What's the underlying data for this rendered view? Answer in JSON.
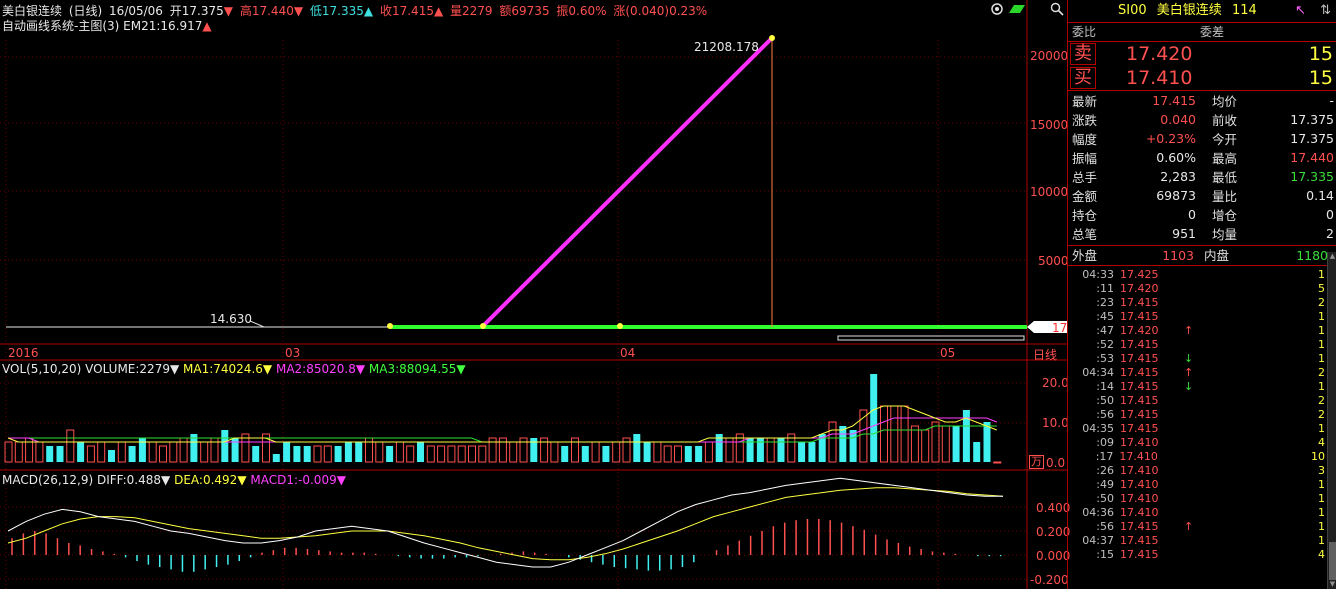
{
  "header": {
    "name": "美白银连续",
    "period": "(日线)",
    "date": "16/05/06",
    "open": "开17.375",
    "high": "高17.440",
    "low": "低17.335",
    "close": "收17.415",
    "volume": "量2279",
    "amount": "额69735",
    "amplitude": "振0.60%",
    "change": "涨(0.040)0.23%",
    "subtitle1": "自动画线系统-主图(3)",
    "subtitle2": "EM21:16.917"
  },
  "main_chart": {
    "peak_label": "21208.178",
    "trough_label": "14.630",
    "y_ticks": [
      "20000",
      "15000",
      "10000",
      "5000"
    ],
    "current_marker": "17",
    "x_ticks": [
      "2016",
      "03",
      "04",
      "05"
    ],
    "period_tag": "日线"
  },
  "volume_chart": {
    "title": "VOL(5,10,20)",
    "vol": "VOLUME:2279",
    "ma1": "MA1:74024.6",
    "ma2": "MA2:85020.8",
    "ma3": "MA3:88094.55",
    "y_ticks": [
      "20.0",
      "10.0",
      "0.0"
    ],
    "unit_label": "万",
    "bars": [
      5,
      5,
      6,
      5,
      4,
      4,
      8,
      5,
      4,
      5,
      3,
      5,
      4,
      6,
      5,
      4,
      5,
      6,
      7,
      5,
      6,
      8,
      6,
      7,
      4,
      7,
      2,
      5,
      4,
      4,
      4,
      4,
      4,
      5,
      5,
      6,
      5,
      4,
      5,
      4,
      5,
      4,
      4,
      4,
      4,
      4,
      4,
      6,
      6,
      5,
      6,
      6,
      6,
      5,
      4,
      6,
      4,
      5,
      4,
      5,
      6,
      7,
      5,
      5,
      4,
      4,
      4,
      4,
      5,
      7,
      6,
      7,
      6,
      6,
      6,
      6,
      7,
      5,
      5,
      7,
      10,
      9,
      8,
      13,
      22,
      14,
      14,
      14,
      9,
      8,
      10,
      9,
      9,
      13,
      5,
      10,
      0
    ],
    "bar_colors": [
      "r",
      "r",
      "r",
      "r",
      "c",
      "c",
      "r",
      "c",
      "r",
      "r",
      "c",
      "r",
      "c",
      "c",
      "r",
      "r",
      "r",
      "r",
      "c",
      "r",
      "r",
      "c",
      "c",
      "r",
      "c",
      "r",
      "c",
      "c",
      "c",
      "c",
      "r",
      "r",
      "c",
      "c",
      "c",
      "r",
      "r",
      "c",
      "r",
      "r",
      "c",
      "r",
      "r",
      "r",
      "r",
      "r",
      "r",
      "r",
      "r",
      "r",
      "r",
      "c",
      "r",
      "r",
      "c",
      "r",
      "c",
      "r",
      "c",
      "r",
      "r",
      "c",
      "c",
      "r",
      "r",
      "r",
      "c",
      "c",
      "r",
      "c",
      "r",
      "r",
      "c",
      "c",
      "r",
      "c",
      "r",
      "c",
      "c",
      "c",
      "r",
      "c",
      "c",
      "r",
      "c",
      "r",
      "r",
      "r",
      "r",
      "r",
      "r",
      "r",
      "c",
      "c",
      "c",
      "c",
      "r"
    ],
    "ma_a": [
      6,
      5,
      5,
      5,
      5,
      5,
      5,
      5,
      5,
      5,
      5,
      5,
      5,
      5,
      5,
      5,
      5,
      5,
      5,
      5,
      5,
      5,
      6,
      6,
      6,
      6,
      5,
      5,
      5,
      5,
      5,
      5,
      5,
      5,
      5,
      5,
      5,
      5,
      5,
      5,
      5,
      5,
      5,
      5,
      5,
      5,
      5,
      5,
      5,
      5,
      5,
      5,
      5,
      5,
      5,
      5,
      5,
      5,
      5,
      5,
      5,
      5,
      5,
      5,
      5,
      5,
      5,
      5,
      6,
      6,
      6,
      6,
      6,
      6,
      6,
      6,
      6,
      6,
      6,
      7,
      8,
      8,
      9,
      11,
      13,
      14,
      14,
      14,
      13,
      12,
      11,
      10,
      10,
      11,
      10,
      9,
      8
    ],
    "ma_b": [
      6,
      6,
      6,
      5,
      5,
      5,
      5,
      5,
      5,
      5,
      5,
      5,
      5,
      5,
      5,
      5,
      5,
      5,
      5,
      5,
      5,
      5,
      5,
      5,
      5,
      5,
      5,
      5,
      5,
      5,
      5,
      5,
      5,
      5,
      5,
      5,
      5,
      5,
      5,
      5,
      5,
      5,
      5,
      5,
      5,
      5,
      5,
      5,
      5,
      5,
      5,
      5,
      5,
      5,
      5,
      5,
      5,
      5,
      5,
      5,
      5,
      5,
      5,
      5,
      5,
      5,
      5,
      5,
      5,
      5,
      5,
      5,
      6,
      6,
      6,
      6,
      6,
      6,
      6,
      6,
      7,
      7,
      7,
      8,
      9,
      10,
      11,
      11,
      11,
      11,
      11,
      11,
      11,
      11,
      11,
      11,
      10
    ],
    "ma_c": [
      6,
      6,
      6,
      6,
      6,
      6,
      6,
      6,
      6,
      6,
      6,
      6,
      6,
      6,
      6,
      6,
      6,
      6,
      6,
      6,
      6,
      6,
      6,
      6,
      6,
      6,
      6,
      6,
      6,
      6,
      6,
      6,
      6,
      6,
      6,
      6,
      6,
      6,
      6,
      6,
      6,
      6,
      6,
      6,
      6,
      6,
      5,
      5,
      5,
      5,
      5,
      5,
      5,
      5,
      5,
      5,
      5,
      5,
      5,
      5,
      5,
      5,
      5,
      5,
      5,
      5,
      5,
      5,
      5,
      5,
      5,
      5,
      5,
      5,
      5,
      5,
      5,
      5,
      5,
      6,
      6,
      6,
      6,
      7,
      7,
      8,
      8,
      8,
      8,
      8,
      9,
      9,
      9,
      9,
      9,
      9,
      9
    ]
  },
  "macd_chart": {
    "title": "MACD(26,12,9)",
    "diff": "DIFF:0.488",
    "dea": "DEA:0.492",
    "macd1": "MACD1:-0.009",
    "y_ticks": [
      "0.400",
      "0.200",
      "0.000",
      "-0.200"
    ],
    "hist": [
      0.14,
      0.18,
      0.2,
      0.18,
      0.14,
      0.1,
      0.08,
      0.05,
      0.03,
      0.01,
      -0.02,
      -0.05,
      -0.08,
      -0.1,
      -0.12,
      -0.14,
      -0.14,
      -0.12,
      -0.1,
      -0.08,
      -0.05,
      -0.02,
      0.02,
      0.04,
      0.06,
      0.06,
      0.05,
      0.04,
      0.03,
      0.02,
      0.02,
      0.02,
      0.01,
      0.0,
      -0.01,
      -0.02,
      -0.03,
      -0.03,
      -0.03,
      -0.02,
      -0.02,
      -0.01,
      0.0,
      0.01,
      0.02,
      0.03,
      0.02,
      0.01,
      0.0,
      -0.02,
      -0.04,
      -0.06,
      -0.08,
      -0.1,
      -0.11,
      -0.12,
      -0.13,
      -0.13,
      -0.12,
      -0.1,
      -0.06,
      0.0,
      0.04,
      0.08,
      0.12,
      0.16,
      0.2,
      0.24,
      0.27,
      0.29,
      0.3,
      0.3,
      0.29,
      0.27,
      0.24,
      0.21,
      0.17,
      0.13,
      0.1,
      0.07,
      0.05,
      0.03,
      0.02,
      0.01,
      0.0,
      -0.01,
      -0.01,
      -0.01
    ],
    "diff_line": [
      0.2,
      0.28,
      0.34,
      0.38,
      0.36,
      0.32,
      0.3,
      0.28,
      0.24,
      0.2,
      0.18,
      0.15,
      0.12,
      0.1,
      0.1,
      0.12,
      0.15,
      0.2,
      0.22,
      0.24,
      0.22,
      0.2,
      0.15,
      0.1,
      0.06,
      0.02,
      -0.02,
      -0.06,
      -0.08,
      -0.1,
      -0.1,
      -0.06,
      0.0,
      0.06,
      0.12,
      0.2,
      0.28,
      0.36,
      0.42,
      0.46,
      0.5,
      0.52,
      0.55,
      0.58,
      0.6,
      0.62,
      0.64,
      0.62,
      0.6,
      0.58,
      0.56,
      0.54,
      0.52,
      0.5,
      0.49,
      0.49
    ],
    "dea_line": [
      0.1,
      0.14,
      0.2,
      0.26,
      0.3,
      0.32,
      0.32,
      0.31,
      0.28,
      0.25,
      0.22,
      0.2,
      0.18,
      0.16,
      0.14,
      0.14,
      0.15,
      0.16,
      0.18,
      0.2,
      0.2,
      0.2,
      0.18,
      0.16,
      0.13,
      0.1,
      0.06,
      0.03,
      0.0,
      -0.03,
      -0.04,
      -0.04,
      -0.02,
      0.01,
      0.05,
      0.1,
      0.15,
      0.2,
      0.26,
      0.32,
      0.36,
      0.4,
      0.44,
      0.48,
      0.5,
      0.52,
      0.54,
      0.55,
      0.56,
      0.56,
      0.55,
      0.54,
      0.53,
      0.51,
      0.5,
      0.49
    ]
  },
  "panel": {
    "code": "SI00",
    "name": "美白银连续",
    "count": "114",
    "weibi_label": "委比",
    "weicha_label": "委差",
    "sell_label": "卖",
    "sell_price": "17.420",
    "sell_vol": "15",
    "buy_label": "买",
    "buy_price": "17.410",
    "buy_vol": "15",
    "stats": [
      {
        "k": "最新",
        "v": "17.415",
        "vc": "r",
        "k2": "均价",
        "v2": "-",
        "v2c": "w"
      },
      {
        "k": "涨跌",
        "v": "0.040",
        "vc": "r",
        "k2": "前收",
        "v2": "17.375",
        "v2c": "w"
      },
      {
        "k": "幅度",
        "v": "+0.23%",
        "vc": "r",
        "k2": "今开",
        "v2": "17.375",
        "v2c": "w"
      },
      {
        "k": "振幅",
        "v": "0.60%",
        "vc": "w",
        "k2": "最高",
        "v2": "17.440",
        "v2c": "r"
      },
      {
        "k": "总手",
        "v": "2,283",
        "vc": "w",
        "k2": "最低",
        "v2": "17.335",
        "v2c": "g"
      },
      {
        "k": "金额",
        "v": "69873",
        "vc": "w",
        "k2": "量比",
        "v2": "0.14",
        "v2c": "w"
      },
      {
        "k": "持仓",
        "v": "0",
        "vc": "w",
        "k2": "增仓",
        "v2": "0",
        "v2c": "w"
      },
      {
        "k": "总笔",
        "v": "951",
        "vc": "w",
        "k2": "均量",
        "v2": "2",
        "v2c": "w"
      }
    ],
    "waipan_label": "外盘",
    "waipan": "1103",
    "neipan_label": "内盘",
    "neipan": "1180",
    "ticks": [
      {
        "t": "04:33",
        "p": "17.425",
        "a": "",
        "ac": "w",
        "q": "1"
      },
      {
        "t": ":11",
        "p": "17.420",
        "a": "",
        "ac": "w",
        "q": "5"
      },
      {
        "t": ":23",
        "p": "17.415",
        "a": "",
        "ac": "w",
        "q": "2"
      },
      {
        "t": ":45",
        "p": "17.415",
        "a": "",
        "ac": "w",
        "q": "1"
      },
      {
        "t": ":47",
        "p": "17.420",
        "a": "↑",
        "ac": "r",
        "q": "1"
      },
      {
        "t": ":52",
        "p": "17.415",
        "a": "",
        "ac": "w",
        "q": "1"
      },
      {
        "t": ":53",
        "p": "17.415",
        "a": "↓",
        "ac": "g",
        "q": "1"
      },
      {
        "t": "04:34",
        "p": "17.415",
        "a": "↑",
        "ac": "r",
        "q": "2"
      },
      {
        "t": ":14",
        "p": "17.415",
        "a": "↓",
        "ac": "g",
        "q": "1"
      },
      {
        "t": ":50",
        "p": "17.415",
        "a": "",
        "ac": "w",
        "q": "2"
      },
      {
        "t": ":56",
        "p": "17.415",
        "a": "",
        "ac": "w",
        "q": "2"
      },
      {
        "t": "04:35",
        "p": "17.415",
        "a": "",
        "ac": "w",
        "q": "1"
      },
      {
        "t": ":09",
        "p": "17.410",
        "a": "",
        "ac": "w",
        "q": "4"
      },
      {
        "t": ":17",
        "p": "17.410",
        "a": "",
        "ac": "w",
        "q": "10"
      },
      {
        "t": ":26",
        "p": "17.410",
        "a": "",
        "ac": "w",
        "q": "3"
      },
      {
        "t": ":49",
        "p": "17.410",
        "a": "",
        "ac": "w",
        "q": "1"
      },
      {
        "t": ":50",
        "p": "17.410",
        "a": "",
        "ac": "w",
        "q": "1"
      },
      {
        "t": "04:36",
        "p": "17.410",
        "a": "",
        "ac": "w",
        "q": "1"
      },
      {
        "t": ":56",
        "p": "17.415",
        "a": "↑",
        "ac": "r",
        "q": "1"
      },
      {
        "t": "04:37",
        "p": "17.415",
        "a": "",
        "ac": "w",
        "q": "1"
      },
      {
        "t": ":15",
        "p": "17.415",
        "a": "",
        "ac": "w",
        "q": "4"
      }
    ]
  }
}
